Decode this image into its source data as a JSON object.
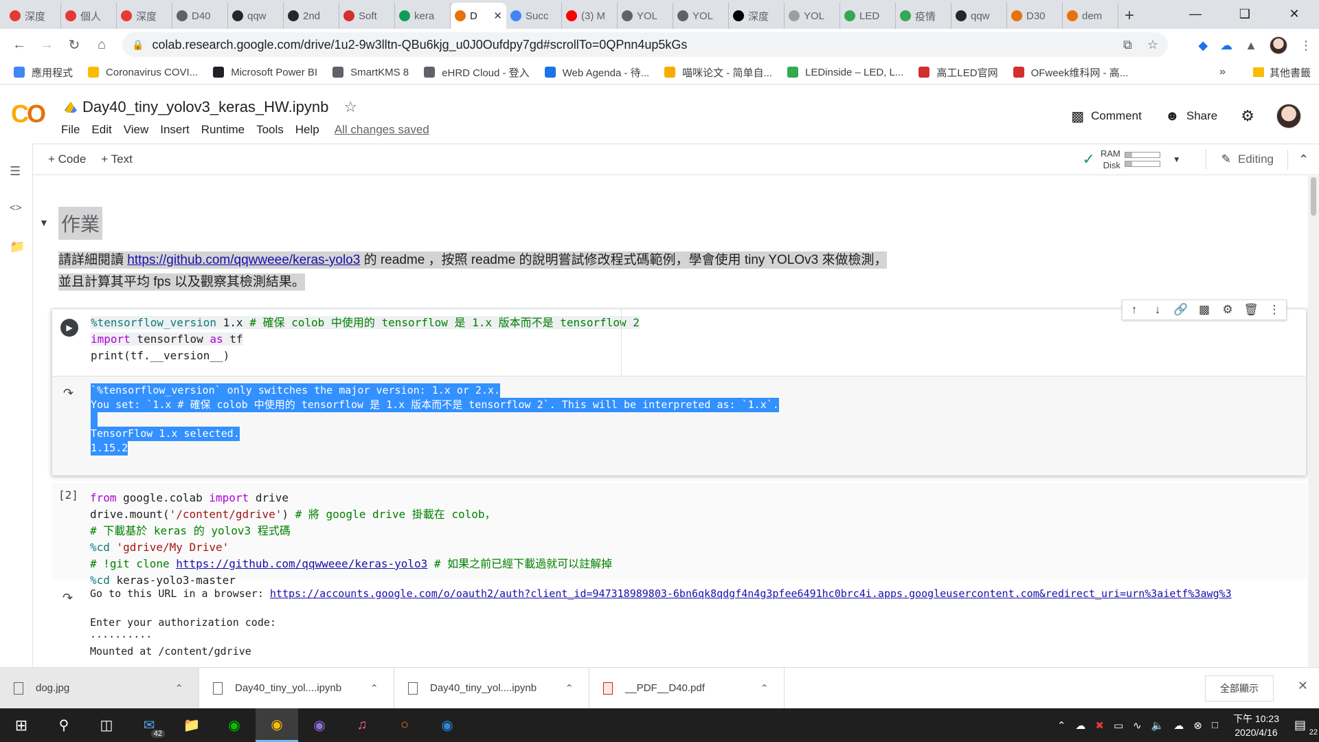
{
  "browser": {
    "tabs": [
      {
        "label": "深度",
        "color": "#e53935"
      },
      {
        "label": "個人",
        "color": "#e53935"
      },
      {
        "label": "深度",
        "color": "#e53935"
      },
      {
        "label": "D40",
        "color": "#5f6368"
      },
      {
        "label": "qqw",
        "color": "#24292e"
      },
      {
        "label": "2nd",
        "color": "#24292e"
      },
      {
        "label": "Soft",
        "color": "#d32f2f"
      },
      {
        "label": "kera",
        "color": "#0f9d58"
      },
      {
        "label": "D",
        "color": "#e8710a",
        "active": true
      },
      {
        "label": "Succ",
        "color": "#4285f4"
      },
      {
        "label": "(3) M",
        "color": "#ff0000"
      },
      {
        "label": "YOL",
        "color": "#5f6368"
      },
      {
        "label": "YOL",
        "color": "#5f6368"
      },
      {
        "label": "深度",
        "color": "#000000"
      },
      {
        "label": "YOL",
        "color": "#9e9e9e"
      },
      {
        "label": "LED",
        "color": "#34a853"
      },
      {
        "label": "疫情",
        "color": "#34a853"
      },
      {
        "label": "qqw",
        "color": "#24292e"
      },
      {
        "label": "D30",
        "color": "#e8710a"
      },
      {
        "label": "dem",
        "color": "#e8710a"
      }
    ],
    "new_tab": "+",
    "url": "colab.research.google.com/drive/1u2-9w3lltn-QBu6kjg_u0J0Oufdpy7gd#scrollTo=0QPnn4up5kGs",
    "bookmarks": [
      {
        "label": "應用程式",
        "color": "#4285f4"
      },
      {
        "label": "Coronavirus COVI...",
        "color": "#fbbc05"
      },
      {
        "label": "Microsoft Power BI",
        "color": "#202124"
      },
      {
        "label": "SmartKMS 8",
        "color": "#5f6368"
      },
      {
        "label": "eHRD Cloud - 登入",
        "color": "#5f6368"
      },
      {
        "label": "Web Agenda - 待...",
        "color": "#1a73e8"
      },
      {
        "label": "喵咪论文 - 简单自...",
        "color": "#f9ab00"
      },
      {
        "label": "LEDinside – LED, L...",
        "color": "#34a853"
      },
      {
        "label": "高工LED官网",
        "color": "#d32f2f"
      },
      {
        "label": "OFweek维科网 - 高...",
        "color": "#d32f2f"
      }
    ],
    "bookmarks_more": "»",
    "other_bookmarks": "其他書籤"
  },
  "colab": {
    "logo": "CO",
    "notebook_title": "Day40_tiny_yolov3_keras_HW.ipynb",
    "menus": [
      "File",
      "Edit",
      "View",
      "Insert",
      "Runtime",
      "Tools",
      "Help"
    ],
    "save_status": "All changes saved",
    "comment_label": "Comment",
    "share_label": "Share",
    "add_code": "+ Code",
    "add_text": "+ Text",
    "ram_label": "RAM",
    "disk_label": "Disk",
    "editing_label": "Editing",
    "ram_used": 0.2,
    "disk_used": 0.2
  },
  "notebook": {
    "section_heading": "作業",
    "para_before_link": "請詳細閱讀 ",
    "para_link": "https://github.com/qqwweee/keras-yolo3",
    "para_after_link": " 的 readme ，按照 readme 的說明嘗試修改程式碼範例，學會使用 tiny YOLOv3 來做檢測，",
    "para_line2": "並且計算其平均 fps 以及觀察其檢測結果。",
    "cell1": {
      "line1_magic": "%tensorflow_version",
      "line1_num": " 1.x",
      "line1_comment": " # 確保 colob 中使用的 tensorflow 是 1.x 版本而不是 tensorflow 2",
      "line2_kw": "import",
      "line2_mid": " tensorflow ",
      "line2_as": "as",
      "line2_end": " tf",
      "line3": "print(tf.__version__)",
      "output": [
        "`%tensorflow_version` only switches the major version: 1.x or 2.x.",
        "You set: `1.x # 確保 colob 中使用的 tensorflow 是 1.x 版本而不是 tensorflow 2`. This will be interpreted as: `1.x`.",
        " ",
        "TensorFlow 1.x selected.",
        "1.15.2"
      ]
    },
    "cell2": {
      "exec_count": "[2]",
      "l1_kw1": "from",
      "l1_mid": " google.colab ",
      "l1_kw2": "import",
      "l1_end": " drive",
      "l2_code": "drive.mount(",
      "l2_str": "'/content/gdrive'",
      "l2_close": ") ",
      "l2_comment": "# 將 google drive 掛載在 colob，",
      "l3_comment": "# 下載基於 keras 的 yolov3 程式碼",
      "l4_magic": "%cd ",
      "l4_str": "'gdrive/My Drive'",
      "l5_comment_a": "# !git clone ",
      "l5_link": "https://github.com/qqwweee/keras-yolo3",
      "l5_comment_b": " # 如果之前已經下載過就可以註解掉",
      "l6_magic": "%cd",
      "l6_end": " keras-yolo3-master"
    },
    "cell2_output": {
      "goto_text": "Go to this URL in a browser: ",
      "auth_url": "https://accounts.google.com/o/oauth2/auth?client_id=947318989803-6bn6qk8qdgf4n4g3pfee6491hc0brc4i.apps.googleusercontent.com&redirect_uri=urn%3aietf%3awg%3",
      "enter_code": "Enter your authorization code:",
      "masked": "··········",
      "mounted": "Mounted at /content/gdrive"
    }
  },
  "downloads": [
    {
      "name": "dog.jpg",
      "type": "image"
    },
    {
      "name": "Day40_tiny_yol....ipynb",
      "type": "file"
    },
    {
      "name": "Day40_tiny_yol....ipynb",
      "type": "file"
    },
    {
      "name": "__PDF__D40.pdf",
      "type": "pdf"
    }
  ],
  "downloads_show_all": "全部顯示",
  "taskbar": {
    "mail_badge": "42",
    "time": "下午 10:23",
    "date": "2020/4/16",
    "notification_count": "22"
  }
}
